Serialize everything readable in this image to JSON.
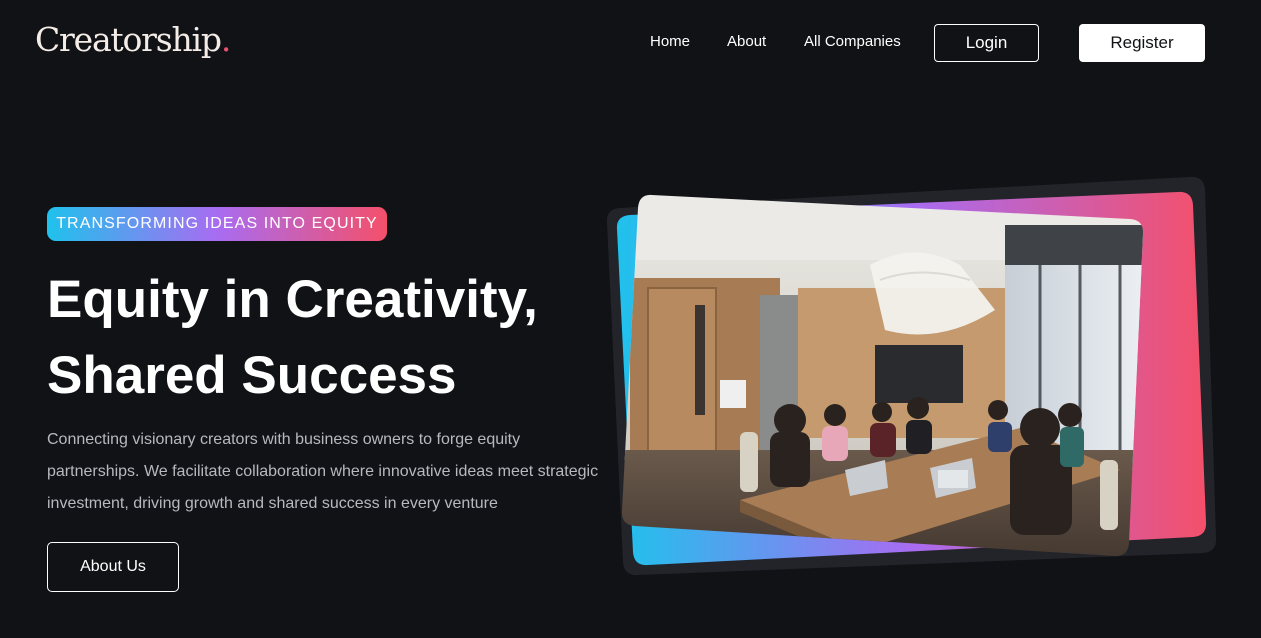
{
  "brand": {
    "logo_text": "Creatorship",
    "logo_dot": "."
  },
  "nav": {
    "home": "Home",
    "about": "About",
    "all_companies": "All Companies",
    "login": "Login",
    "register": "Register"
  },
  "hero": {
    "badge": "TRANSFORMING IDEAS INTO EQUITY",
    "headline_line1": "Equity in Creativity,",
    "headline_line2": "Shared Success",
    "description": "Connecting visionary creators with business owners to forge equity partnerships. We facilitate collaboration where innovative ideas meet strategic investment, driving growth and shared success in every venture",
    "cta": "About Us",
    "image_icon": "meeting-photo"
  },
  "colors": {
    "background": "#111216",
    "gradient_start": "#1fc2ec",
    "gradient_mid": "#a86cf2",
    "gradient_end": "#f4506a",
    "text_muted": "#b8b8bf",
    "logo_accent": "#e8546b"
  }
}
